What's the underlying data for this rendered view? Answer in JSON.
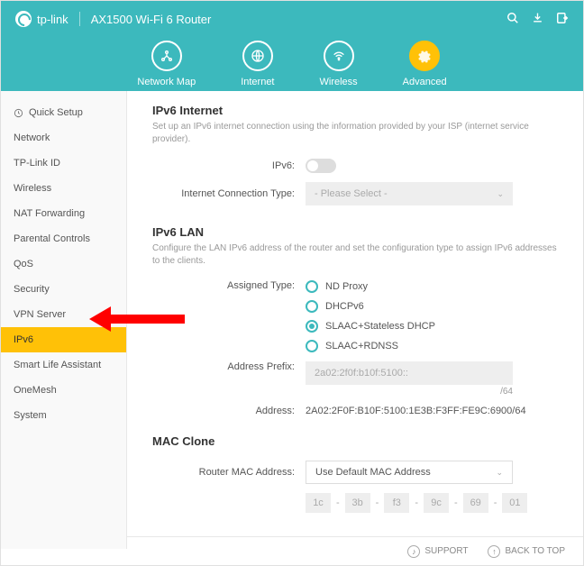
{
  "brand": "tp-link",
  "product": "AX1500 Wi-Fi 6 Router",
  "tabs": {
    "map": "Network Map",
    "internet": "Internet",
    "wireless": "Wireless",
    "advanced": "Advanced"
  },
  "sidebar": {
    "items": [
      "Quick Setup",
      "Network",
      "TP-Link ID",
      "Wireless",
      "NAT Forwarding",
      "Parental Controls",
      "QoS",
      "Security",
      "VPN Server",
      "IPv6",
      "Smart Life Assistant",
      "OneMesh",
      "System"
    ]
  },
  "ipv6internet": {
    "title": "IPv6 Internet",
    "desc": "Set up an IPv6 internet connection using the information provided by your ISP (internet service provider).",
    "ipv6label": "IPv6:",
    "conntype_label": "Internet Connection Type:",
    "conntype_placeholder": "- Please Select -"
  },
  "ipv6lan": {
    "title": "IPv6 LAN",
    "desc": "Configure the LAN IPv6 address of the router and set the configuration type to assign IPv6 addresses to the clients.",
    "assigned_label": "Assigned Type:",
    "opts": [
      "ND Proxy",
      "DHCPv6",
      "SLAAC+Stateless DHCP",
      "SLAAC+RDNSS"
    ],
    "prefix_label": "Address Prefix:",
    "prefix_value": "2a02:2f0f:b10f:5100::",
    "prefix_suffix": "/64",
    "addr_label": "Address:",
    "addr_value": "2A02:2F0F:B10F:5100:1E3B:F3FF:FE9C:6900/64"
  },
  "mac": {
    "title": "MAC Clone",
    "lbl": "Router MAC Address:",
    "val": "Use Default MAC Address",
    "octets": [
      "1c",
      "3b",
      "f3",
      "9c",
      "69",
      "01"
    ]
  },
  "footer": {
    "support": "SUPPORT",
    "backtop": "BACK TO TOP"
  }
}
